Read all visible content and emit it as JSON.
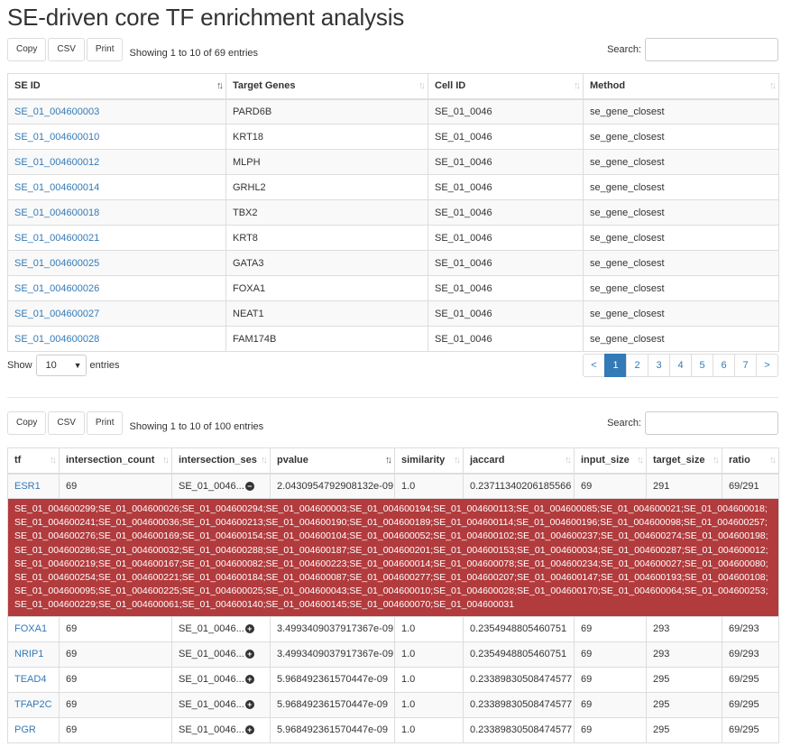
{
  "title": "SE-driven core TF enrichment analysis",
  "top": {
    "buttons": [
      "Copy",
      "CSV",
      "Print"
    ],
    "info": "Showing 1 to 10 of 69 entries",
    "search_label": "Search:",
    "columns": [
      "SE ID",
      "Target Genes",
      "Cell ID",
      "Method"
    ],
    "rows": [
      [
        "SE_01_004600003",
        "PARD6B",
        "SE_01_0046",
        "se_gene_closest"
      ],
      [
        "SE_01_004600010",
        "KRT18",
        "SE_01_0046",
        "se_gene_closest"
      ],
      [
        "SE_01_004600012",
        "MLPH",
        "SE_01_0046",
        "se_gene_closest"
      ],
      [
        "SE_01_004600014",
        "GRHL2",
        "SE_01_0046",
        "se_gene_closest"
      ],
      [
        "SE_01_004600018",
        "TBX2",
        "SE_01_0046",
        "se_gene_closest"
      ],
      [
        "SE_01_004600021",
        "KRT8",
        "SE_01_0046",
        "se_gene_closest"
      ],
      [
        "SE_01_004600025",
        "GATA3",
        "SE_01_0046",
        "se_gene_closest"
      ],
      [
        "SE_01_004600026",
        "FOXA1",
        "SE_01_0046",
        "se_gene_closest"
      ],
      [
        "SE_01_004600027",
        "NEAT1",
        "SE_01_0046",
        "se_gene_closest"
      ],
      [
        "SE_01_004600028",
        "FAM174B",
        "SE_01_0046",
        "se_gene_closest"
      ]
    ],
    "show_label": "Show",
    "entries_label": "entries",
    "page_length": "10",
    "pages": [
      "<",
      "1",
      "2",
      "3",
      "4",
      "5",
      "6",
      "7",
      ">"
    ],
    "active_page": "1"
  },
  "bottom": {
    "buttons": [
      "Copy",
      "CSV",
      "Print"
    ],
    "info": "Showing 1 to 10 of 100 entries",
    "search_label": "Search:",
    "columns": [
      "tf",
      "intersection_count",
      "intersection_ses",
      "pvalue",
      "similarity",
      "jaccard",
      "input_size",
      "target_size",
      "ratio"
    ],
    "first_row": [
      "ESR1",
      "69",
      "SE_01_0046...",
      "2.0430954792908132e-09",
      "1.0",
      "0.23711340206185566",
      "69",
      "291",
      "69/291"
    ],
    "detail_text": "SE_01_004600299;SE_01_004600026;SE_01_004600294;SE_01_004600003;SE_01_004600194;SE_01_004600113;SE_01_004600085;SE_01_004600021;SE_01_004600018;SE_01_004600241;SE_01_004600036;SE_01_004600213;SE_01_004600190;SE_01_004600189;SE_01_004600114;SE_01_004600196;SE_01_004600098;SE_01_004600257;SE_01_004600276;SE_01_004600169;SE_01_004600154;SE_01_004600104;SE_01_004600052;SE_01_004600102;SE_01_004600237;SE_01_004600274;SE_01_004600198;SE_01_004600286;SE_01_004600032;SE_01_004600288;SE_01_004600187;SE_01_004600201;SE_01_004600153;SE_01_004600034;SE_01_004600287;SE_01_004600012;SE_01_004600219;SE_01_004600167;SE_01_004600082;SE_01_004600223;SE_01_004600014;SE_01_004600078;SE_01_004600234;SE_01_004600027;SE_01_004600080;SE_01_004600254;SE_01_004600221;SE_01_004600184;SE_01_004600087;SE_01_004600277;SE_01_004600207;SE_01_004600147;SE_01_004600193;SE_01_004600108;SE_01_004600095;SE_01_004600225;SE_01_004600025;SE_01_004600043;SE_01_004600010;SE_01_004600028;SE_01_004600170;SE_01_004600064;SE_01_004600253;SE_01_004600229;SE_01_004600061;SE_01_004600140;SE_01_004600145;SE_01_004600070;SE_01_004600031",
    "rows": [
      [
        "FOXA1",
        "69",
        "SE_01_0046...",
        "3.4993409037917367e-09",
        "1.0",
        "0.2354948805460751",
        "69",
        "293",
        "69/293"
      ],
      [
        "NRIP1",
        "69",
        "SE_01_0046...",
        "3.4993409037917367e-09",
        "1.0",
        "0.2354948805460751",
        "69",
        "293",
        "69/293"
      ],
      [
        "TEAD4",
        "69",
        "SE_01_0046...",
        "5.968492361570447e-09",
        "1.0",
        "0.23389830508474577",
        "69",
        "295",
        "69/295"
      ],
      [
        "TFAP2C",
        "69",
        "SE_01_0046...",
        "5.968492361570447e-09",
        "1.0",
        "0.23389830508474577",
        "69",
        "295",
        "69/295"
      ],
      [
        "PGR",
        "69",
        "SE_01_0046...",
        "5.968492361570447e-09",
        "1.0",
        "0.23389830508474577",
        "69",
        "295",
        "69/295"
      ]
    ]
  }
}
